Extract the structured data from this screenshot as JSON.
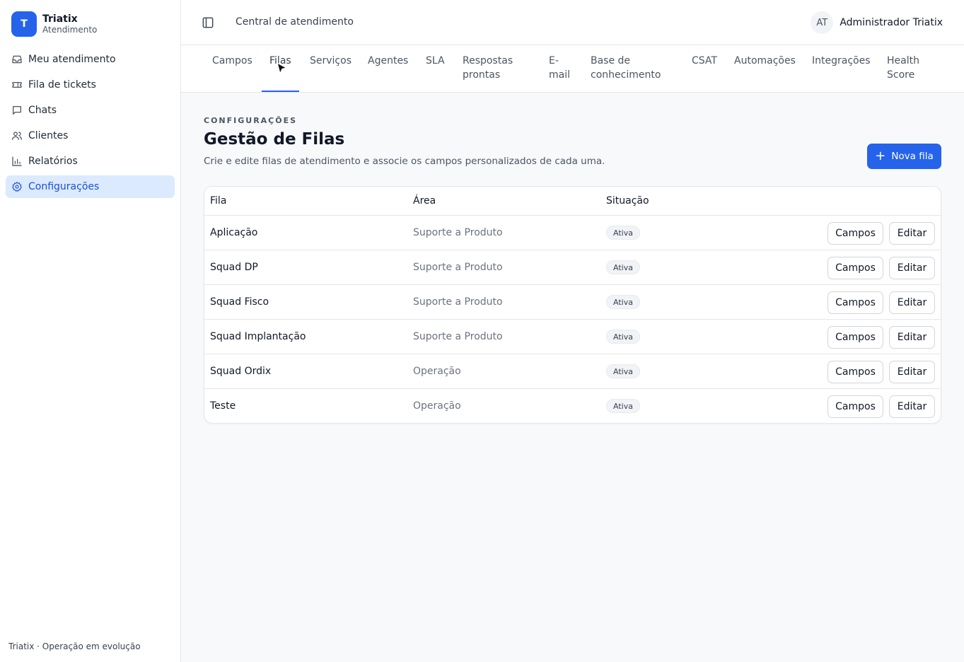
{
  "brand": {
    "initial": "T",
    "name": "Triatix",
    "subtitle": "Atendimento"
  },
  "sidebar": {
    "items": [
      {
        "label": "Meu atendimento",
        "icon": "inbox-icon"
      },
      {
        "label": "Fila de tickets",
        "icon": "ticket-icon"
      },
      {
        "label": "Chats",
        "icon": "chat-icon"
      },
      {
        "label": "Clientes",
        "icon": "users-icon"
      },
      {
        "label": "Relatórios",
        "icon": "bar-chart-icon"
      },
      {
        "label": "Configurações",
        "icon": "gear-icon",
        "active": true
      }
    ],
    "footer": "Triatix · Operação em evolução"
  },
  "header": {
    "title": "Central de atendimento",
    "user": {
      "initials": "AT",
      "name": "Administrador Triatix"
    }
  },
  "tabs": [
    {
      "label": "Campos"
    },
    {
      "label": "Filas",
      "active": true
    },
    {
      "label": "Serviços"
    },
    {
      "label": "Agentes"
    },
    {
      "label": "SLA"
    },
    {
      "label": "Respostas prontas"
    },
    {
      "label": "E-mail"
    },
    {
      "label": "Base de conhecimento"
    },
    {
      "label": "CSAT"
    },
    {
      "label": "Automações"
    },
    {
      "label": "Integrações"
    },
    {
      "label": "Health Score"
    }
  ],
  "main": {
    "eyebrow": "CONFIGURAÇÕES",
    "title": "Gestão de Filas",
    "description": "Crie e edite filas de atendimento e associe os campos personalizados de cada uma.",
    "new_button": "Nova fila"
  },
  "table": {
    "headers": {
      "name": "Fila",
      "area": "Área",
      "status": "Situação"
    },
    "rows": [
      {
        "name": "Aplicação",
        "area": "Suporte a Produto",
        "status": "Ativa",
        "fields_btn": "Campos",
        "edit_btn": "Editar"
      },
      {
        "name": "Squad DP",
        "area": "Suporte a Produto",
        "status": "Ativa",
        "fields_btn": "Campos",
        "edit_btn": "Editar"
      },
      {
        "name": "Squad Fisco",
        "area": "Suporte a Produto",
        "status": "Ativa",
        "fields_btn": "Campos",
        "edit_btn": "Editar"
      },
      {
        "name": "Squad Implantação",
        "area": "Suporte a Produto",
        "status": "Ativa",
        "fields_btn": "Campos",
        "edit_btn": "Editar"
      },
      {
        "name": "Squad Ordix",
        "area": "Operação",
        "status": "Ativa",
        "fields_btn": "Campos",
        "edit_btn": "Editar"
      },
      {
        "name": "Teste",
        "area": "Operação",
        "status": "Ativa",
        "fields_btn": "Campos",
        "edit_btn": "Editar"
      }
    ]
  },
  "colors": {
    "accent": "#2563eb",
    "active_nav_bg": "#dbeafe"
  }
}
